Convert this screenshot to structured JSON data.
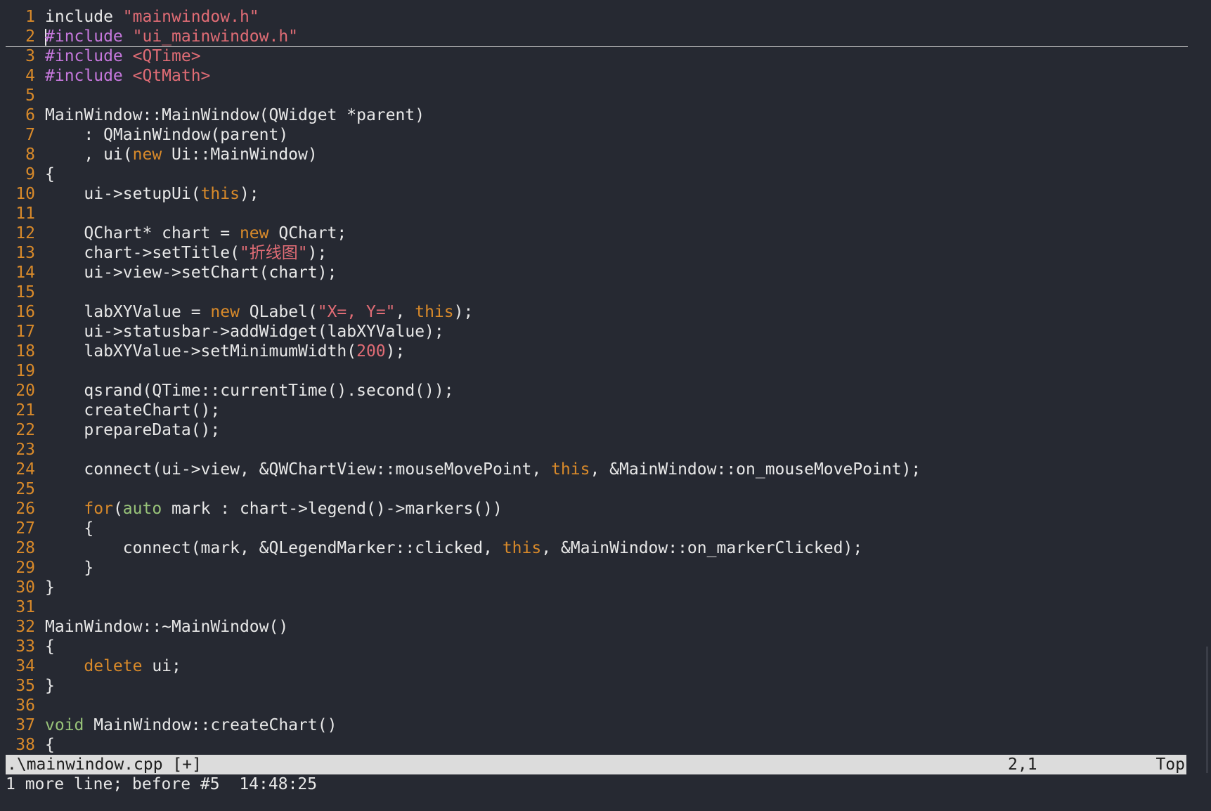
{
  "editor": {
    "lines": [
      {
        "n": "1",
        "segs": [
          [
            "plain",
            "include "
          ],
          [
            "str",
            "\"mainwindow.h\""
          ]
        ]
      },
      {
        "n": "2",
        "cursor": true,
        "segs": [
          [
            "pre",
            "#include "
          ],
          [
            "str",
            "\"ui_mainwindow.h\""
          ]
        ]
      },
      {
        "n": "3",
        "segs": [
          [
            "pre",
            "#include "
          ],
          [
            "str",
            "<QTime>"
          ]
        ]
      },
      {
        "n": "4",
        "segs": [
          [
            "pre",
            "#include "
          ],
          [
            "str",
            "<QtMath>"
          ]
        ]
      },
      {
        "n": "5",
        "segs": []
      },
      {
        "n": "6",
        "segs": [
          [
            "plain",
            "MainWindow::MainWindow(QWidget *parent)"
          ]
        ]
      },
      {
        "n": "7",
        "segs": [
          [
            "plain",
            "    : QMainWindow(parent)"
          ]
        ]
      },
      {
        "n": "8",
        "segs": [
          [
            "plain",
            "    , ui("
          ],
          [
            "kw",
            "new"
          ],
          [
            "plain",
            " Ui::MainWindow)"
          ]
        ]
      },
      {
        "n": "9",
        "segs": [
          [
            "plain",
            "{"
          ]
        ]
      },
      {
        "n": "10",
        "segs": [
          [
            "plain",
            "    ui->setupUi("
          ],
          [
            "kw",
            "this"
          ],
          [
            "plain",
            ");"
          ]
        ]
      },
      {
        "n": "11",
        "segs": []
      },
      {
        "n": "12",
        "segs": [
          [
            "plain",
            "    QChart* chart = "
          ],
          [
            "kw",
            "new"
          ],
          [
            "plain",
            " QChart;"
          ]
        ]
      },
      {
        "n": "13",
        "segs": [
          [
            "plain",
            "    chart->setTitle("
          ],
          [
            "str",
            "\"折线图\""
          ],
          [
            "plain",
            ");"
          ]
        ]
      },
      {
        "n": "14",
        "segs": [
          [
            "plain",
            "    ui->view->setChart(chart);"
          ]
        ]
      },
      {
        "n": "15",
        "segs": []
      },
      {
        "n": "16",
        "segs": [
          [
            "plain",
            "    labXYValue = "
          ],
          [
            "kw",
            "new"
          ],
          [
            "plain",
            " QLabel("
          ],
          [
            "str",
            "\"X=, Y=\""
          ],
          [
            "plain",
            ", "
          ],
          [
            "kw",
            "this"
          ],
          [
            "plain",
            ");"
          ]
        ]
      },
      {
        "n": "17",
        "segs": [
          [
            "plain",
            "    ui->statusbar->addWidget(labXYValue);"
          ]
        ]
      },
      {
        "n": "18",
        "segs": [
          [
            "plain",
            "    labXYValue->setMinimumWidth("
          ],
          [
            "num",
            "200"
          ],
          [
            "plain",
            ");"
          ]
        ]
      },
      {
        "n": "19",
        "segs": []
      },
      {
        "n": "20",
        "segs": [
          [
            "plain",
            "    qsrand(QTime::currentTime().second());"
          ]
        ]
      },
      {
        "n": "21",
        "segs": [
          [
            "plain",
            "    createChart();"
          ]
        ]
      },
      {
        "n": "22",
        "segs": [
          [
            "plain",
            "    prepareData();"
          ]
        ]
      },
      {
        "n": "23",
        "segs": []
      },
      {
        "n": "24",
        "segs": [
          [
            "plain",
            "    connect(ui->view, &QWChartView::mouseMovePoint, "
          ],
          [
            "kw",
            "this"
          ],
          [
            "plain",
            ", &MainWindow::on_mouseMovePoint);"
          ]
        ]
      },
      {
        "n": "25",
        "segs": []
      },
      {
        "n": "26",
        "segs": [
          [
            "plain",
            "    "
          ],
          [
            "kw",
            "for"
          ],
          [
            "plain",
            "("
          ],
          [
            "type",
            "auto"
          ],
          [
            "plain",
            " mark : chart->legend()->markers())"
          ]
        ]
      },
      {
        "n": "27",
        "segs": [
          [
            "plain",
            "    {"
          ]
        ]
      },
      {
        "n": "28",
        "segs": [
          [
            "plain",
            "        connect(mark, &QLegendMarker::clicked, "
          ],
          [
            "kw",
            "this"
          ],
          [
            "plain",
            ", &MainWindow::on_markerClicked);"
          ]
        ]
      },
      {
        "n": "29",
        "segs": [
          [
            "plain",
            "    }"
          ]
        ]
      },
      {
        "n": "30",
        "segs": [
          [
            "plain",
            "}"
          ]
        ]
      },
      {
        "n": "31",
        "segs": []
      },
      {
        "n": "32",
        "segs": [
          [
            "plain",
            "MainWindow::~MainWindow()"
          ]
        ]
      },
      {
        "n": "33",
        "segs": [
          [
            "plain",
            "{"
          ]
        ]
      },
      {
        "n": "34",
        "segs": [
          [
            "plain",
            "    "
          ],
          [
            "kw",
            "delete"
          ],
          [
            "plain",
            " ui;"
          ]
        ]
      },
      {
        "n": "35",
        "segs": [
          [
            "plain",
            "}"
          ]
        ]
      },
      {
        "n": "36",
        "segs": []
      },
      {
        "n": "37",
        "segs": [
          [
            "type",
            "void"
          ],
          [
            "plain",
            " MainWindow::createChart()"
          ]
        ]
      },
      {
        "n": "38",
        "segs": [
          [
            "plain",
            "{"
          ]
        ]
      }
    ]
  },
  "statusline": {
    "filename": ".\\mainwindow.cpp [+]",
    "position": "2,1",
    "scroll": "Top"
  },
  "cmdline": {
    "message": "1 more line; before #5  14:48:25"
  },
  "colors": {
    "background": "#262932",
    "line_number": "#d98a2a",
    "preproc": "#c678dd",
    "string": "#e06c75",
    "keyword": "#d98a2a",
    "type": "#98c379",
    "statusline_bg": "#dcdcdc"
  }
}
